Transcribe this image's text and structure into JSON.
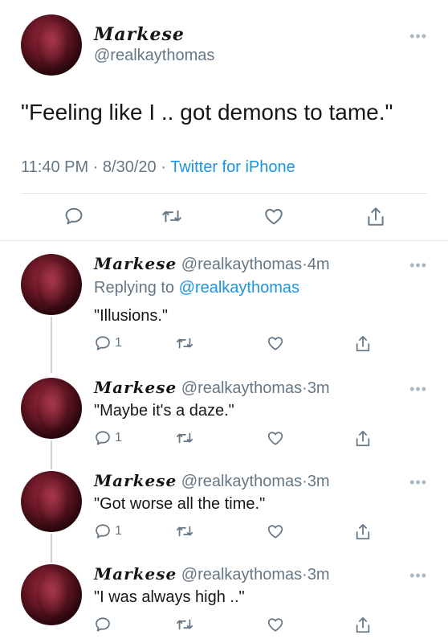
{
  "main_tweet": {
    "display_name": "Markese",
    "handle": "@realkaythomas",
    "text": "\"Feeling like I .. got demons to tame.\"",
    "time": "11:40 PM",
    "date": "8/30/20",
    "source": "Twitter for iPhone",
    "more": "•••"
  },
  "separator": "·",
  "replies": [
    {
      "display_name": "Markese",
      "handle": "@realkaythomas",
      "age": "4m",
      "replying_label": "Replying to",
      "replying_to": "@realkaythomas",
      "text": "\"Illusions.\"",
      "reply_count": "1",
      "more": "•••"
    },
    {
      "display_name": "Markese",
      "handle": "@realkaythomas",
      "age": "3m",
      "text": "\"Maybe it's a daze.\"",
      "reply_count": "1",
      "more": "•••"
    },
    {
      "display_name": "Markese",
      "handle": "@realkaythomas",
      "age": "3m",
      "text": "\"Got worse all the time.\"",
      "reply_count": "1",
      "more": "•••"
    },
    {
      "display_name": "Markese",
      "handle": "@realkaythomas",
      "age": "3m",
      "text": "\"I was always high ..\"",
      "reply_count": "",
      "more": "•••"
    }
  ],
  "colors": {
    "link": "#1b95e0",
    "muted": "#657786",
    "divider": "#e1e8ed"
  },
  "icons": [
    "reply-icon",
    "retweet-icon",
    "like-icon",
    "share-icon",
    "more-icon"
  ]
}
